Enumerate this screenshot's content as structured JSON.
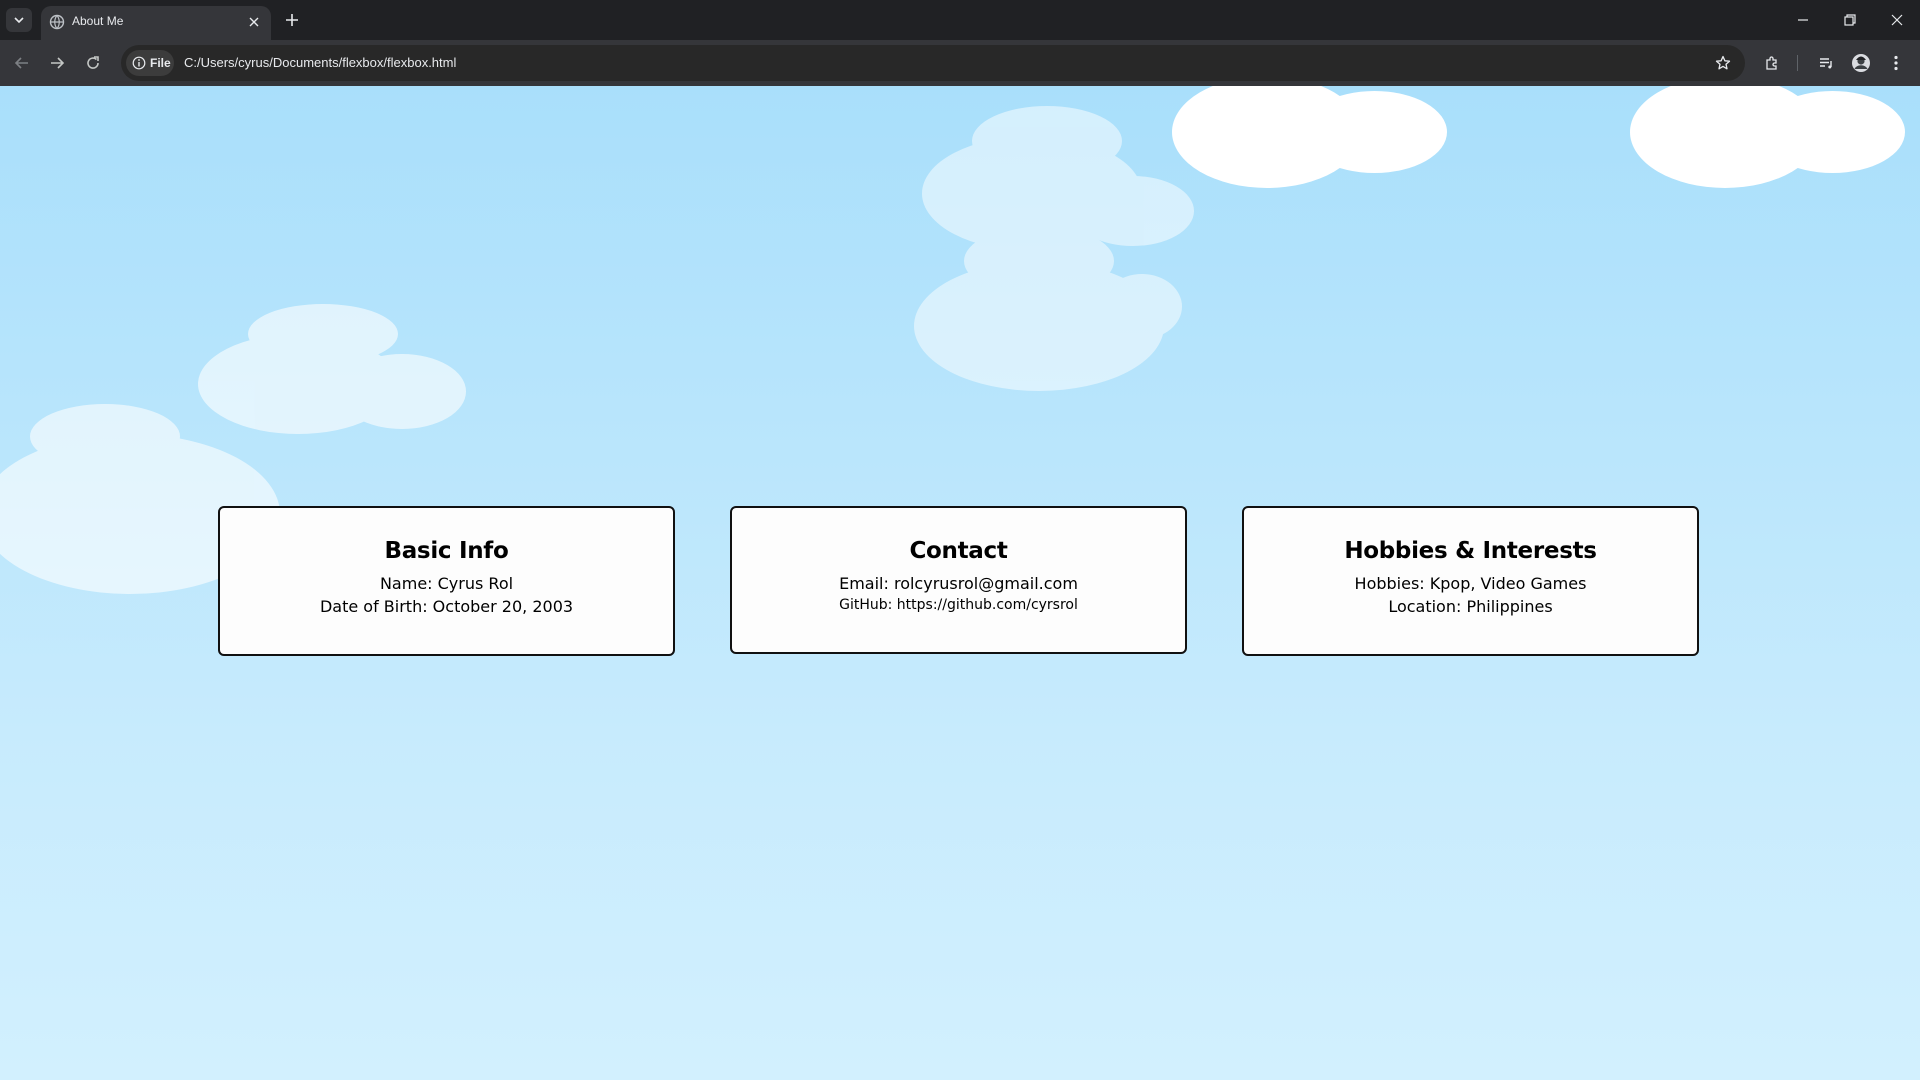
{
  "browser": {
    "tab_title": "About Me",
    "site_chip": "File",
    "url": "C:/Users/cyrus/Documents/flexbox/flexbox.html"
  },
  "icons": [
    "tab-list-icon",
    "globe-icon",
    "close-icon",
    "plus-icon",
    "minimize-icon",
    "restore-icon",
    "back-icon",
    "forward-icon",
    "reload-icon",
    "info-icon",
    "star-icon",
    "extensions-icon",
    "media-icon",
    "profile-icon",
    "menu-icon"
  ],
  "colors": {
    "sky_top": "#a9dffb",
    "sky_bottom": "#d2f0fe",
    "card_bg": "#fdfdfd",
    "card_border": "#111111"
  },
  "cards": [
    {
      "title": "Basic Info",
      "lines": [
        "Name: Cyrus Rol",
        "Date of Birth: October 20, 2003"
      ]
    },
    {
      "title": "Contact",
      "lines": [
        "Email: rolcyrusrol@gmail.com",
        "GitHub: https://github.com/cyrsrol"
      ]
    },
    {
      "title": "Hobbies & Interests",
      "lines": [
        "Hobbies: Kpop, Video Games",
        "Location: Philippines"
      ]
    }
  ]
}
